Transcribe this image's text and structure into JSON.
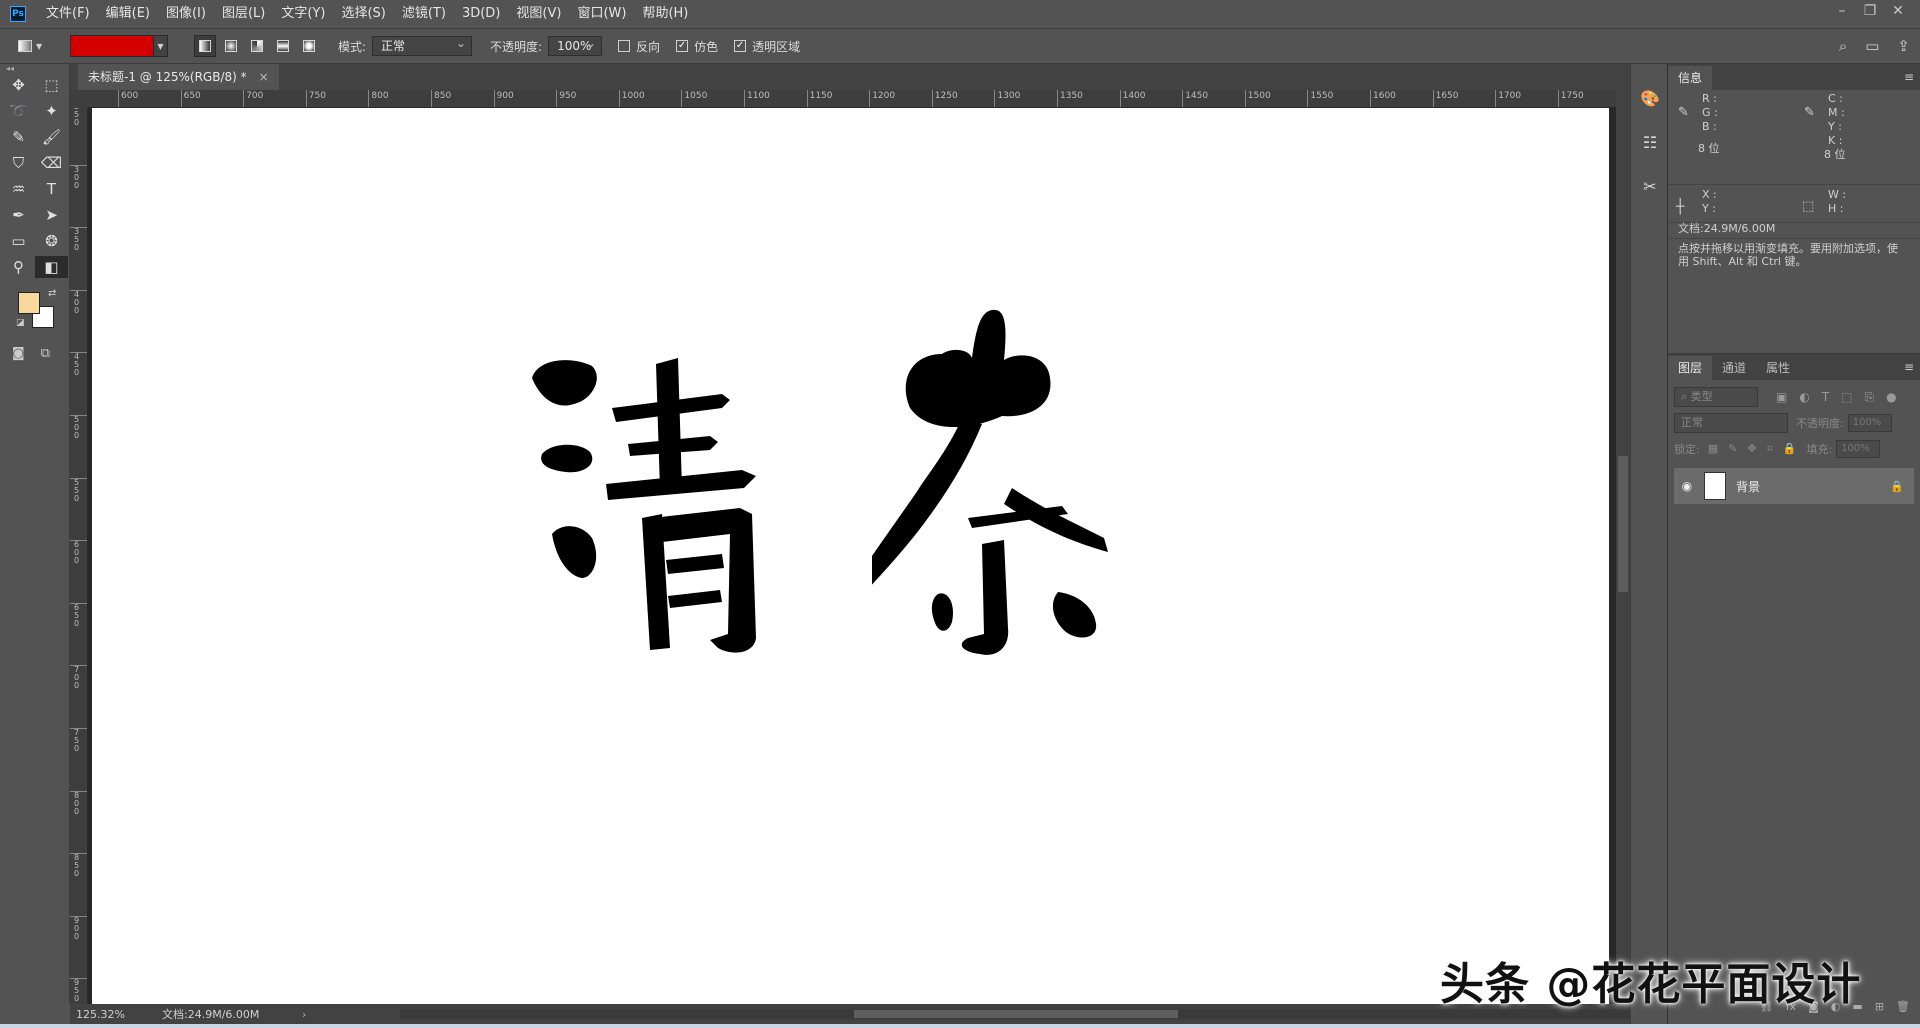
{
  "menubar": {
    "logo": "Ps",
    "items": [
      "文件(F)",
      "编辑(E)",
      "图像(I)",
      "图层(L)",
      "文字(Y)",
      "选择(S)",
      "滤镜(T)",
      "3D(D)",
      "视图(V)",
      "窗口(W)",
      "帮助(H)"
    ]
  },
  "options": {
    "mode_label": "模式:",
    "mode_value": "正常",
    "opacity_label": "不透明度:",
    "opacity_value": "100%",
    "reverse_label": "反向",
    "dither_label": "仿色",
    "transparency_label": "透明区域",
    "gradient_color": "#d40000"
  },
  "document": {
    "tab_title": "未标题-1 @ 125%(RGB/8) *",
    "canvas_text_1": "清",
    "canvas_text_2": "茶"
  },
  "ruler": {
    "h_ticks": [
      "600",
      "650",
      "700",
      "750",
      "800",
      "850",
      "900",
      "950",
      "1000",
      "1050",
      "1100",
      "1150",
      "1200",
      "1250",
      "1300",
      "1350",
      "1400",
      "1450",
      "1500",
      "1550",
      "1600",
      "1650",
      "1700",
      "1750"
    ],
    "v_ticks": [
      "250",
      "300",
      "350",
      "400",
      "450",
      "500",
      "550",
      "600",
      "650",
      "700",
      "750",
      "800",
      "850",
      "900",
      "950"
    ]
  },
  "status": {
    "zoom": "125.32%",
    "doc_info": "文档:24.9M/6.00M"
  },
  "colors": {
    "foreground": "#f9d89d",
    "background": "#ffffff"
  },
  "info_panel": {
    "tab": "信息",
    "rgb_labels": [
      "R :",
      "G :",
      "B :"
    ],
    "cmyk_labels": [
      "C :",
      "M :",
      "Y :",
      "K :"
    ],
    "bits_left": "8 位",
    "bits_right": "8 位",
    "xy_labels": [
      "X :",
      "Y :"
    ],
    "wh_labels": [
      "W :",
      "H :"
    ],
    "doc_size": "文档:24.9M/6.00M",
    "hint": "点按并拖移以用渐变填充。要用附加选项，使用 Shift、Alt 和 Ctrl 键。"
  },
  "layers_panel": {
    "tabs": [
      "图层",
      "通道",
      "属性"
    ],
    "filter_placeholder": "类型",
    "blend_mode": "正常",
    "opacity_label": "不透明度:",
    "opacity_value": "100%",
    "lock_label": "锁定:",
    "fill_label": "填充:",
    "fill_value": "100%",
    "layer_name": "背景"
  },
  "watermark": "头条 @花花平面设计"
}
